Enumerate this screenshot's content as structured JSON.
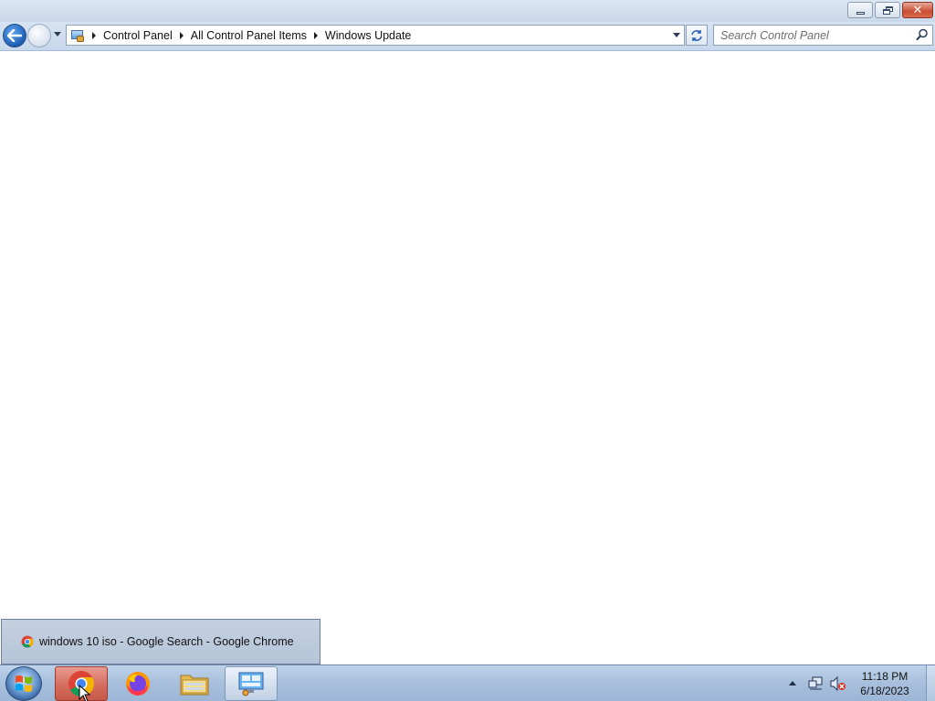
{
  "window": {
    "caption": {
      "minimize": "",
      "restore": "",
      "close": "✕"
    }
  },
  "navbar": {
    "breadcrumbs": [
      "Control Panel",
      "All Control Panel Items",
      "Windows Update"
    ],
    "search_placeholder": "Search Control Panel"
  },
  "tooltip": {
    "title": "windows 10 iso - Google Search - Google Chrome"
  },
  "taskbar": {
    "pinned": [
      {
        "name": "chrome-taskbar-button",
        "icon": "chrome-icon",
        "active": true
      },
      {
        "name": "firefox-taskbar-button",
        "icon": "firefox-icon",
        "active": false
      },
      {
        "name": "explorer-taskbar-button",
        "icon": "folder-icon",
        "active": false
      },
      {
        "name": "control-panel-taskbar-button",
        "icon": "control-panel-icon",
        "active": true
      }
    ],
    "tray": {
      "icons": [
        "network-icon",
        "volume-muted-icon"
      ]
    },
    "clock": {
      "time": "11:18 PM",
      "date": "6/18/2023"
    }
  },
  "colors": {
    "accent": "#1c5db5",
    "taskbar": "#a7bfdc",
    "close_button": "#c84d32",
    "chrome_active": "#d56d5e"
  }
}
